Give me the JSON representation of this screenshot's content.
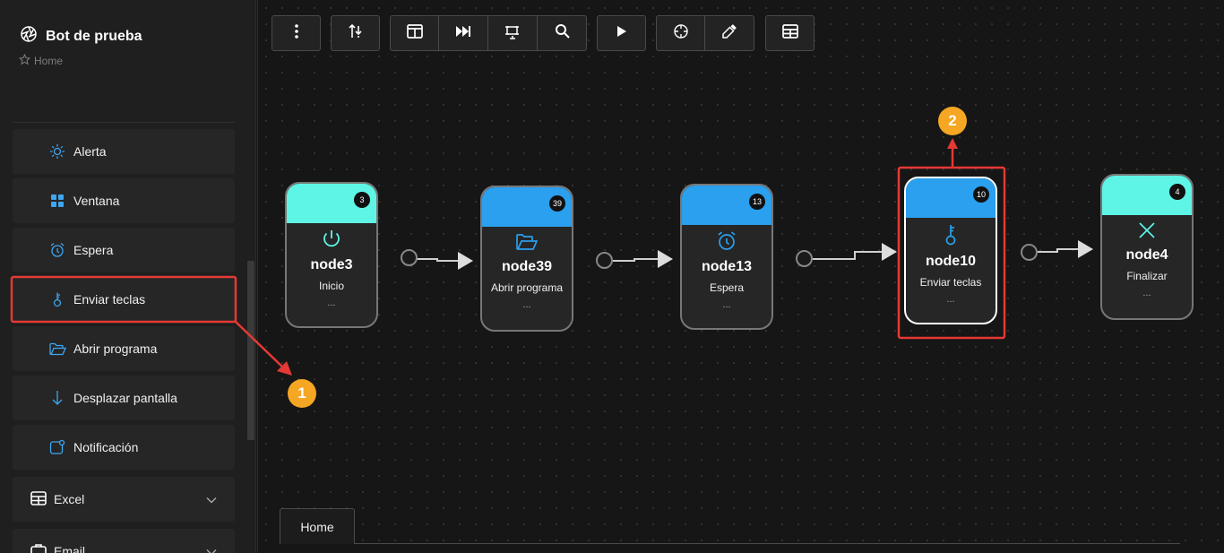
{
  "app": {
    "title": "Bot de prueba",
    "breadcrumb": "Home"
  },
  "sidebar": {
    "items": [
      {
        "label": "Alerta",
        "icon": "sun-icon"
      },
      {
        "label": "Ventana",
        "icon": "grid-icon"
      },
      {
        "label": "Espera",
        "icon": "alarm-clock-icon"
      },
      {
        "label": "Enviar teclas",
        "icon": "key-icon"
      },
      {
        "label": "Abrir programa",
        "icon": "folder-open-icon"
      },
      {
        "label": "Desplazar pantalla",
        "icon": "arrow-down-icon"
      },
      {
        "label": "Notificación",
        "icon": "notification-icon"
      }
    ],
    "groups": [
      {
        "label": "Excel",
        "icon": "table-icon"
      },
      {
        "label": "Email",
        "icon": "email-icon"
      }
    ]
  },
  "toolbar": {
    "buttons": [
      "more-vertical-icon",
      "sort-icon",
      "layout-columns-icon",
      "skip-forward-icon",
      "transform-icon",
      "search-icon",
      "play-icon",
      "crosshair-icon",
      "eyedropper-icon",
      "table-icon"
    ]
  },
  "nodes": [
    {
      "id": "node3",
      "subtitle": "Inicio",
      "badge": "3",
      "dots": "...",
      "color": "#5ef5e6",
      "icon": "power-icon"
    },
    {
      "id": "node39",
      "subtitle": "Abrir programa",
      "badge": "39",
      "dots": "...",
      "color": "#2aa0ee",
      "icon": "folder-open-icon"
    },
    {
      "id": "node13",
      "subtitle": "Espera",
      "badge": "13",
      "dots": "...",
      "color": "#2aa0ee",
      "icon": "alarm-clock-icon"
    },
    {
      "id": "node10",
      "subtitle": "Enviar teclas",
      "badge": "10",
      "dots": "...",
      "color": "#2aa0ee",
      "icon": "key-icon"
    },
    {
      "id": "node4",
      "subtitle": "Finalizar",
      "badge": "4",
      "dots": "...",
      "color": "#5ef5e6",
      "icon": "close-icon"
    }
  ],
  "tabs": [
    {
      "label": "Home"
    }
  ],
  "callouts": [
    {
      "label": "1"
    },
    {
      "label": "2"
    }
  ],
  "colors": {
    "accent": "#2aa0ee",
    "terminal": "#5ef5e6",
    "highlight": "#e53935",
    "callout": "#f5a623"
  }
}
